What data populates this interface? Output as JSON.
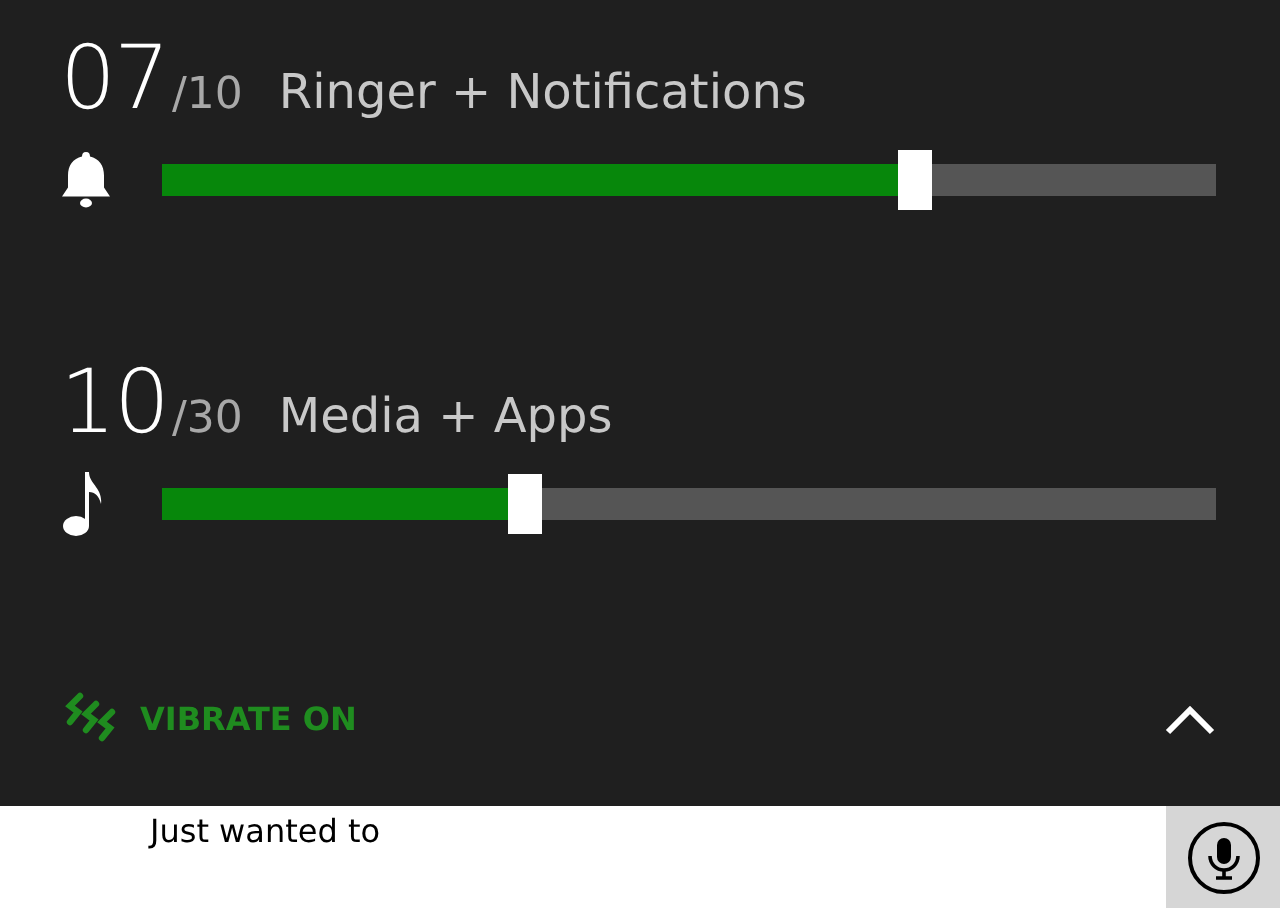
{
  "volumes": [
    {
      "value": "07",
      "max": "/10",
      "label": "Ringer + Notifications",
      "level": 0.7
    },
    {
      "value": "10",
      "max": "/30",
      "label": "Media + Apps",
      "level": 0.33
    }
  ],
  "vibrate": {
    "label": "VIBRATE ON",
    "on": true
  },
  "message": {
    "value": "Just wanted to"
  }
}
